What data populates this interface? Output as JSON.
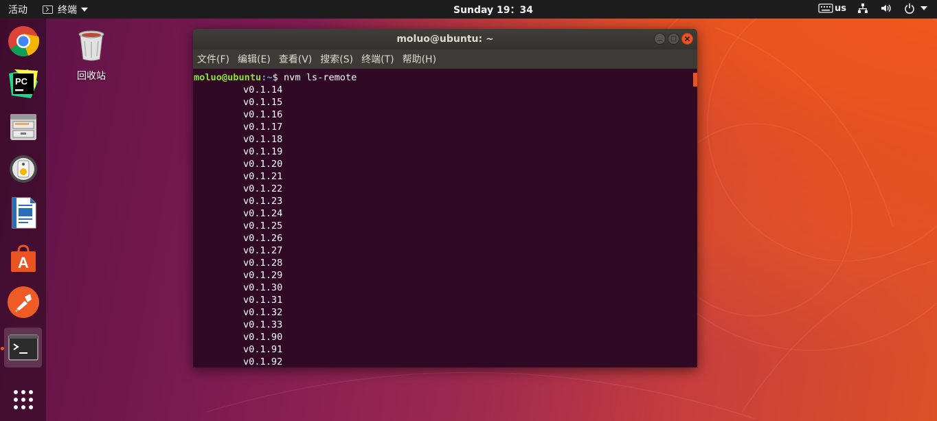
{
  "topbar": {
    "activities": "活动",
    "app_menu": "终端",
    "clock": "Sunday 19：34",
    "keyboard_layout": "us",
    "icons": [
      "keyboard-icon",
      "network-icon",
      "volume-icon",
      "power-icon"
    ]
  },
  "dock": {
    "items": [
      {
        "name": "chrome",
        "icon": "chrome-icon"
      },
      {
        "name": "pycharm",
        "icon": "pycharm-icon"
      },
      {
        "name": "files",
        "icon": "file-cabinet-icon"
      },
      {
        "name": "rhythmbox",
        "icon": "speaker-icon"
      },
      {
        "name": "libreoffice-writer",
        "icon": "writer-document-icon"
      },
      {
        "name": "software-center",
        "icon": "shopping-bag-icon"
      },
      {
        "name": "postman",
        "icon": "postman-icon"
      },
      {
        "name": "terminal",
        "icon": "terminal-icon",
        "active": true
      },
      {
        "name": "show-apps",
        "icon": "app-grid-icon"
      }
    ]
  },
  "desktop": {
    "trash_label": "回收站"
  },
  "window": {
    "title": "moluo@ubuntu: ~",
    "menu": [
      "文件(F)",
      "编辑(E)",
      "查看(V)",
      "搜索(S)",
      "终端(T)",
      "帮助(H)"
    ],
    "prompt_user_host": "moluo@ubuntu",
    "prompt_path": ":~",
    "prompt_symbol": "$ ",
    "command": "nvm ls-remote",
    "output": [
      "v0.1.14",
      "v0.1.15",
      "v0.1.16",
      "v0.1.17",
      "v0.1.18",
      "v0.1.19",
      "v0.1.20",
      "v0.1.21",
      "v0.1.22",
      "v0.1.23",
      "v0.1.24",
      "v0.1.25",
      "v0.1.26",
      "v0.1.27",
      "v0.1.28",
      "v0.1.29",
      "v0.1.30",
      "v0.1.31",
      "v0.1.32",
      "v0.1.33",
      "v0.1.90",
      "v0.1.91",
      "v0.1.92"
    ]
  },
  "colors": {
    "accent": "#e95420",
    "terminal_bg": "#300a24",
    "prompt_user": "#8ae234",
    "prompt_path": "#729fcf"
  }
}
